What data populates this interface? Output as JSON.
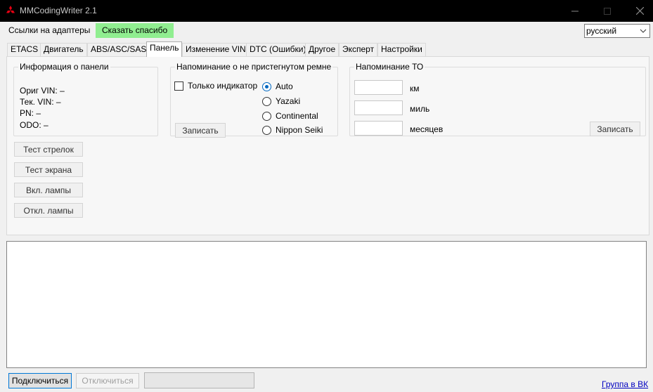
{
  "window": {
    "title": "MMCodingWriter 2.1",
    "logo_icon": "mitsubishi-logo-icon",
    "logo_color": "#e60012"
  },
  "menu": {
    "links_label": "Ссылки на адаптеры",
    "thanks_label": "Сказать спасибо",
    "thanks_color": "#90ee90"
  },
  "language": {
    "selected": "русский"
  },
  "tabs": [
    {
      "label": "ETACS"
    },
    {
      "label": "Двигатель"
    },
    {
      "label": "ABS/ASC/SAS"
    },
    {
      "label": "Панель"
    },
    {
      "label": "Изменение VIN"
    },
    {
      "label": "DTC (Ошибки)"
    },
    {
      "label": "Другое"
    },
    {
      "label": "Эксперт"
    },
    {
      "label": "Настройки"
    }
  ],
  "active_tab": "Панель",
  "panel_info": {
    "title": "Информация о панели",
    "orig_vin": "Ориг VIN: –",
    "cur_vin": "Тек. VIN:  –",
    "pn": "PN:    –",
    "odo": "ODO:   –"
  },
  "panel_buttons": {
    "test_needles": "Тест стрелок",
    "test_screen": "Тест экрана",
    "lamps_on": "Вкл. лампы",
    "lamps_off": "Откл. лампы"
  },
  "belt_reminder": {
    "title": "Напоминание о не пристегнутом ремне",
    "indicator_only_label": "Только индикатор",
    "indicator_only_checked": false,
    "options": [
      {
        "label": "Auto",
        "selected": true
      },
      {
        "label": "Yazaki",
        "selected": false
      },
      {
        "label": "Continental",
        "selected": false
      },
      {
        "label": "Nippon Seiki",
        "selected": false
      }
    ],
    "write_label": "Записать"
  },
  "service_reminder": {
    "title": "Напоминание ТО",
    "km_label": "км",
    "km_value": "",
    "miles_label": "миль",
    "miles_value": "",
    "months_label": "месяцев",
    "months_value": "",
    "write_label": "Записать"
  },
  "log": {
    "text": ""
  },
  "bottom": {
    "connect_label": "Подключиться",
    "disconnect_label": "Отключиться",
    "status_value": "",
    "vk_link": "Группа в ВК"
  }
}
